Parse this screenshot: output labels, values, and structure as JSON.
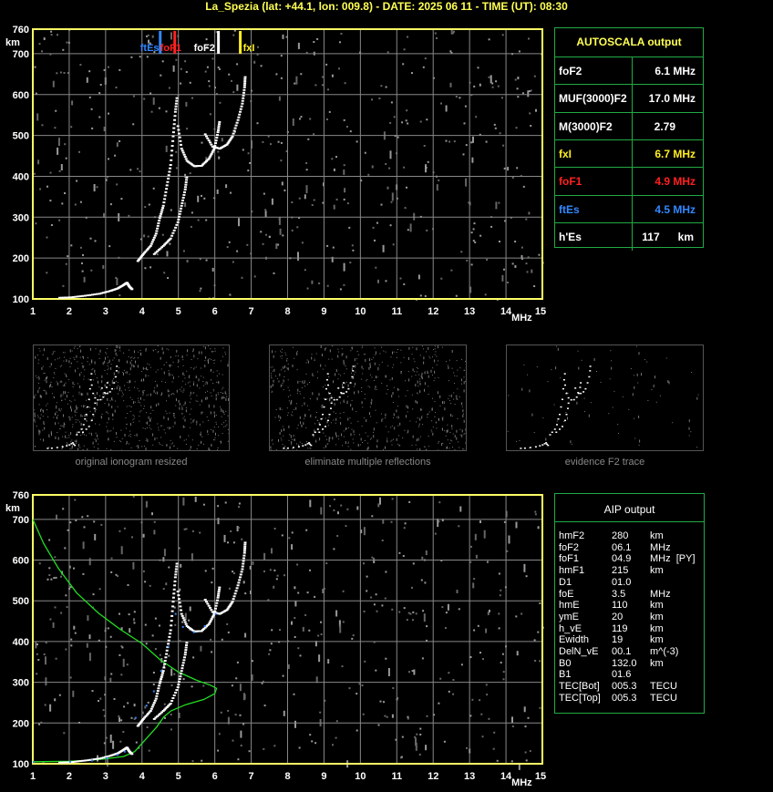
{
  "header": {
    "title": "La_Spezia (lat: +44.1, lon: 009.8) - DATE: 2025 06 11 - TIME (UT): 08:30"
  },
  "colors": {
    "axis": "#ffff66",
    "grid": "#888888",
    "trace": "#ffffff",
    "ftEs": "#3388ff",
    "foF1": "#ff2020",
    "fxI": "#ffee22",
    "profile": "#22dd22",
    "panel_border": "#22aa44"
  },
  "autoscala": {
    "title": "AUTOSCALA output",
    "rows": [
      {
        "label": "foF2",
        "value": "6.1 MHz",
        "color": "#ffffff"
      },
      {
        "label": "MUF(3000)F2",
        "value": "17.0 MHz",
        "color": "#ffffff"
      },
      {
        "label": "M(3000)F2",
        "value": "2.79",
        "color": "#ffffff"
      },
      {
        "label": "fxI",
        "value": "6.7 MHz",
        "color": "#ffee22"
      },
      {
        "label": "foF1",
        "value": "4.9 MHz",
        "color": "#ff2020"
      },
      {
        "label": "ftEs",
        "value": "4.5 MHz",
        "color": "#3388ff"
      },
      {
        "label": "h'Es",
        "value": "117",
        "unit": "km",
        "color": "#ffffff"
      }
    ]
  },
  "aip": {
    "title": "AIP output",
    "rows": [
      {
        "label": "hmF2",
        "value": "280",
        "unit": "km"
      },
      {
        "label": "foF2",
        "value": "06.1",
        "unit": "MHz"
      },
      {
        "label": "foF1",
        "value": "04.9",
        "unit": "MHz  [PY]"
      },
      {
        "label": "hmF1",
        "value": "215",
        "unit": "km"
      },
      {
        "label": "D1",
        "value": "01.0",
        "unit": ""
      },
      {
        "label": "foE",
        "value": "3.5",
        "unit": "MHz"
      },
      {
        "label": "hmE",
        "value": "110",
        "unit": "km"
      },
      {
        "label": "ymE",
        "value": "20",
        "unit": "km"
      },
      {
        "label": "h_vE",
        "value": "119",
        "unit": "km"
      },
      {
        "label": "Ewidth",
        "value": "19",
        "unit": "km"
      },
      {
        "label": "DelN_vE",
        "value": "00.1",
        "unit": "m^(-3)"
      },
      {
        "label": "B0",
        "value": "132.0",
        "unit": "km"
      },
      {
        "label": "B1",
        "value": "01.6",
        "unit": ""
      },
      {
        "label": "TEC[Bot]",
        "value": "005.3",
        "unit": "TECU"
      },
      {
        "label": "TEC[Top]",
        "value": "005.3",
        "unit": "TECU"
      }
    ]
  },
  "thumbnails": [
    {
      "caption": "original ionogram resized"
    },
    {
      "caption": "eliminate multiple reflections"
    },
    {
      "caption": "evidence F2 trace"
    }
  ],
  "chart_data": [
    {
      "type": "scatter",
      "name_key": "ionogram-top",
      "xlabel": "MHz",
      "ylabel": "km",
      "xlim": [
        1,
        15
      ],
      "ylim": [
        100,
        760
      ],
      "xticks": [
        1,
        2,
        3,
        4,
        5,
        6,
        7,
        8,
        9,
        10,
        11,
        12,
        13,
        14,
        15
      ],
      "yticks": [
        100,
        200,
        300,
        400,
        500,
        600,
        700,
        760
      ],
      "grid": true,
      "markers": [
        {
          "label": "ftEs",
          "x": 4.5,
          "color": "#3388ff"
        },
        {
          "label": "foF1",
          "x": 4.9,
          "color": "#ff2020"
        },
        {
          "label": "foF2",
          "x": 6.1,
          "color": "#ffffff"
        },
        {
          "label": "fxI",
          "x": 6.7,
          "color": "#ffee22"
        }
      ],
      "traces": [
        {
          "points": [
            [
              1.7,
              105
            ],
            [
              2.0,
              106
            ],
            [
              2.4,
              110
            ],
            [
              2.8,
              115
            ],
            [
              3.1,
              122
            ],
            [
              3.3,
              128
            ],
            [
              3.45,
              136
            ],
            [
              3.55,
              142
            ],
            [
              3.62,
              132
            ],
            [
              3.7,
              125
            ]
          ]
        },
        {
          "points": [
            [
              3.85,
              195
            ],
            [
              4.0,
              212
            ],
            [
              4.2,
              232
            ],
            [
              4.35,
              262
            ],
            [
              4.45,
              300
            ],
            [
              4.55,
              330
            ],
            [
              4.65,
              380
            ],
            [
              4.75,
              430
            ],
            [
              4.82,
              500
            ],
            [
              4.88,
              560
            ],
            [
              4.93,
              600
            ]
          ]
        },
        {
          "points": [
            [
              4.95,
              525
            ],
            [
              5.05,
              470
            ],
            [
              5.2,
              440
            ],
            [
              5.4,
              427
            ],
            [
              5.6,
              428
            ],
            [
              5.8,
              445
            ],
            [
              5.95,
              470
            ],
            [
              6.05,
              510
            ],
            [
              6.1,
              540
            ]
          ]
        },
        {
          "points": [
            [
              4.3,
              212
            ],
            [
              4.55,
              232
            ],
            [
              4.75,
              250
            ],
            [
              4.95,
              290
            ],
            [
              5.05,
              330
            ],
            [
              5.15,
              370
            ],
            [
              5.2,
              405
            ]
          ]
        },
        {
          "points": [
            [
              5.7,
              505
            ],
            [
              5.9,
              475
            ],
            [
              6.1,
              470
            ],
            [
              6.3,
              480
            ],
            [
              6.45,
              500
            ],
            [
              6.6,
              540
            ],
            [
              6.72,
              580
            ],
            [
              6.78,
              620
            ],
            [
              6.8,
              650
            ]
          ]
        }
      ]
    },
    {
      "type": "scatter",
      "name_key": "ionogram-bottom",
      "xlabel": "MHz",
      "ylabel": "km",
      "xlim": [
        1,
        15
      ],
      "ylim": [
        100,
        760
      ],
      "xticks": [
        1,
        2,
        3,
        4,
        5,
        6,
        7,
        8,
        9,
        10,
        11,
        12,
        13,
        14,
        15
      ],
      "yticks": [
        100,
        200,
        300,
        400,
        500,
        600,
        700,
        760
      ],
      "grid": true,
      "traces": [
        {
          "points": [
            [
              1.7,
              105
            ],
            [
              2.0,
              106
            ],
            [
              2.4,
              110
            ],
            [
              2.8,
              115
            ],
            [
              3.1,
              122
            ],
            [
              3.3,
              128
            ],
            [
              3.45,
              136
            ],
            [
              3.55,
              142
            ],
            [
              3.62,
              132
            ],
            [
              3.7,
              125
            ]
          ]
        },
        {
          "points": [
            [
              3.85,
              195
            ],
            [
              4.0,
              212
            ],
            [
              4.2,
              232
            ],
            [
              4.35,
              262
            ],
            [
              4.45,
              300
            ],
            [
              4.55,
              330
            ],
            [
              4.65,
              380
            ],
            [
              4.75,
              430
            ],
            [
              4.82,
              500
            ],
            [
              4.88,
              560
            ],
            [
              4.93,
              600
            ]
          ]
        },
        {
          "points": [
            [
              4.95,
              525
            ],
            [
              5.05,
              470
            ],
            [
              5.2,
              440
            ],
            [
              5.4,
              427
            ],
            [
              5.6,
              428
            ],
            [
              5.8,
              445
            ],
            [
              5.95,
              470
            ],
            [
              6.05,
              510
            ],
            [
              6.1,
              540
            ]
          ]
        },
        {
          "points": [
            [
              4.3,
              212
            ],
            [
              4.55,
              232
            ],
            [
              4.75,
              250
            ],
            [
              4.95,
              290
            ],
            [
              5.05,
              330
            ],
            [
              5.15,
              370
            ],
            [
              5.2,
              405
            ]
          ]
        },
        {
          "points": [
            [
              5.7,
              505
            ],
            [
              5.9,
              475
            ],
            [
              6.1,
              470
            ],
            [
              6.3,
              480
            ],
            [
              6.45,
              500
            ],
            [
              6.6,
              540
            ],
            [
              6.72,
              580
            ],
            [
              6.78,
              620
            ],
            [
              6.8,
              650
            ]
          ]
        }
      ],
      "profile": {
        "points": [
          [
            1.0,
            700
          ],
          [
            1.3,
            640
          ],
          [
            1.7,
            580
          ],
          [
            2.2,
            520
          ],
          [
            2.8,
            470
          ],
          [
            3.4,
            430
          ],
          [
            4.0,
            395
          ],
          [
            4.5,
            355
          ],
          [
            5.0,
            325
          ],
          [
            5.5,
            305
          ],
          [
            5.9,
            292
          ],
          [
            6.05,
            285
          ],
          [
            6.0,
            272
          ],
          [
            5.7,
            258
          ],
          [
            5.2,
            245
          ],
          [
            4.8,
            230
          ],
          [
            4.6,
            215
          ],
          [
            4.4,
            190
          ],
          [
            4.1,
            160
          ],
          [
            3.8,
            130
          ],
          [
            3.5,
            118
          ],
          [
            3.0,
            112
          ],
          [
            2.5,
            108
          ],
          [
            2.0,
            106
          ],
          [
            1.0,
            105
          ]
        ]
      },
      "fit": {
        "points": [
          [
            1.0,
            106
          ],
          [
            2.0,
            107
          ],
          [
            2.6,
            110
          ],
          [
            3.0,
            116
          ],
          [
            3.3,
            124
          ],
          [
            3.5,
            132
          ],
          [
            3.8,
            215
          ],
          [
            4.1,
            245
          ],
          [
            4.3,
            280
          ],
          [
            4.5,
            330
          ],
          [
            4.7,
            390
          ],
          [
            4.9,
            470
          ],
          [
            5.1,
            438
          ],
          [
            5.4,
            425
          ],
          [
            5.7,
            440
          ],
          [
            6.0,
            470
          ]
        ]
      }
    }
  ]
}
